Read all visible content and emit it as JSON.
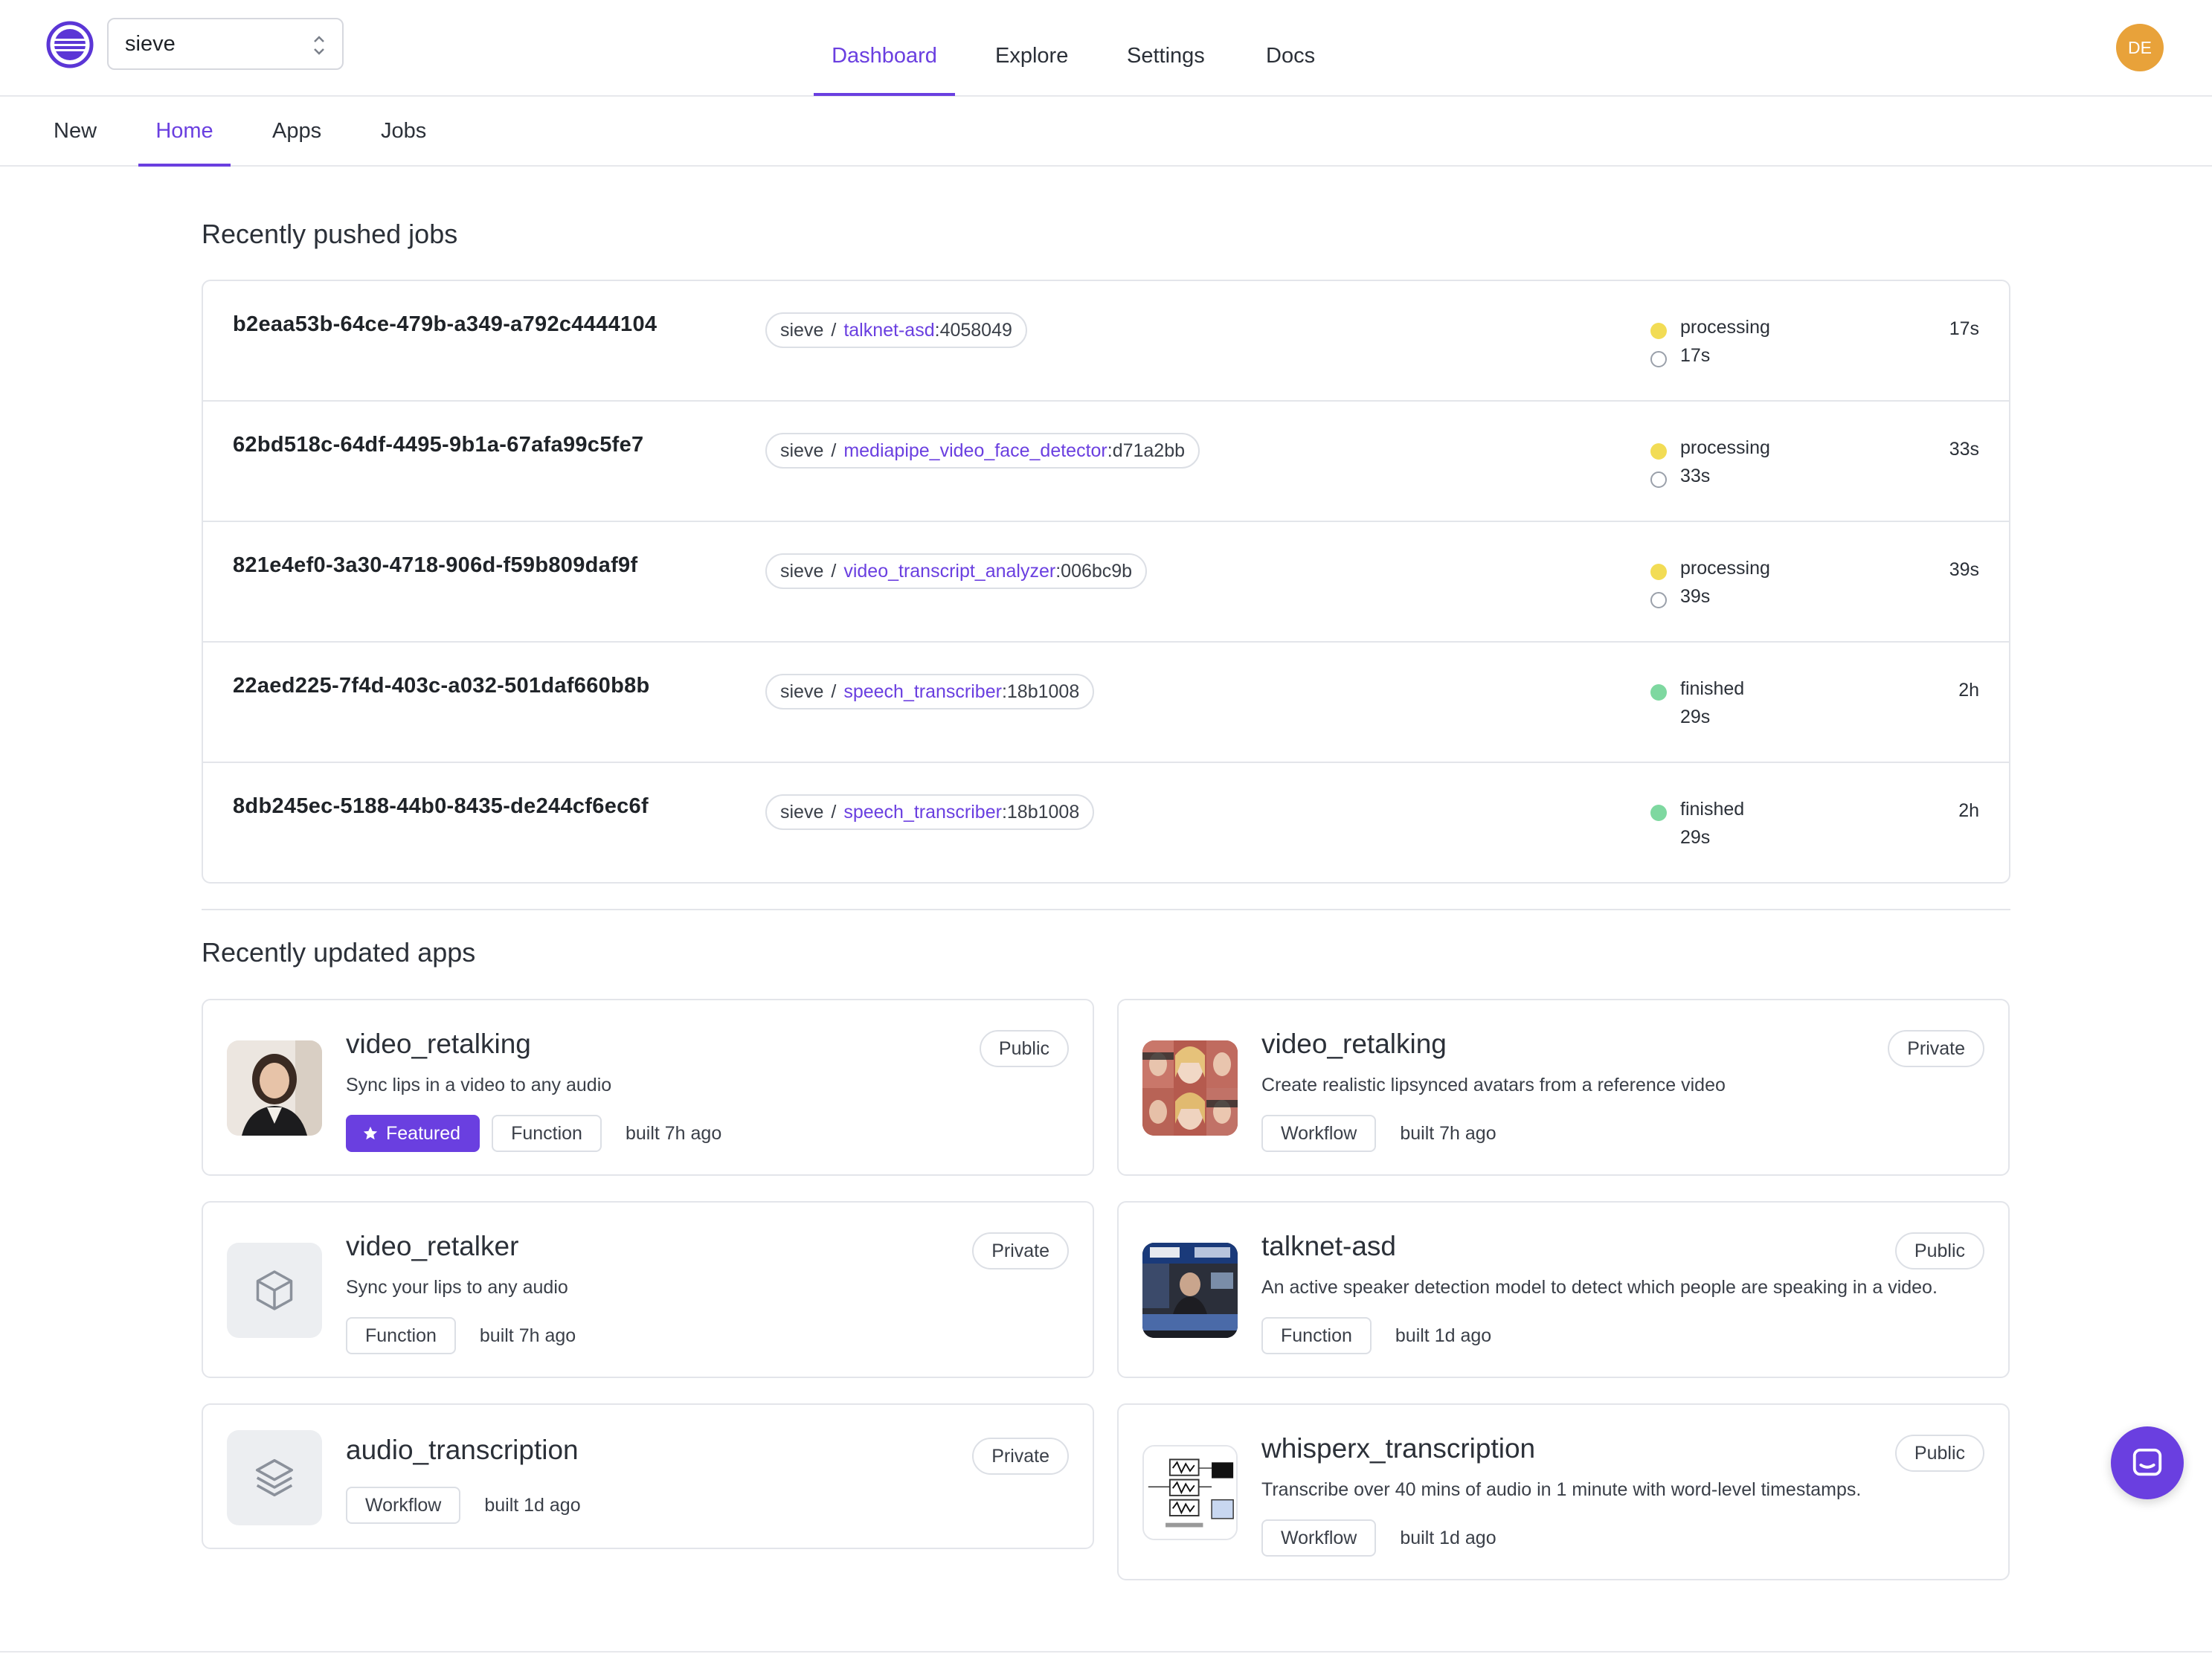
{
  "org_select": {
    "value": "sieve"
  },
  "nav": {
    "dashboard": "Dashboard",
    "explore": "Explore",
    "settings": "Settings",
    "docs": "Docs"
  },
  "user": {
    "initials": "DE"
  },
  "subnav": {
    "new": "New",
    "home": "Home",
    "apps": "Apps",
    "jobs": "Jobs"
  },
  "sections": {
    "jobs_title": "Recently pushed jobs",
    "apps_title": "Recently updated apps"
  },
  "jobs": [
    {
      "id": "b2eaa53b-64ce-479b-a349-a792c4444104",
      "owner": "sieve",
      "sep": "/",
      "app": "talknet-asd",
      "version": ":4058049",
      "status": "processing",
      "status_sub": "17s",
      "duration": "17s"
    },
    {
      "id": "62bd518c-64df-4495-9b1a-67afa99c5fe7",
      "owner": "sieve",
      "sep": "/",
      "app": "mediapipe_video_face_detector",
      "version": ":d71a2bb",
      "status": "processing",
      "status_sub": "33s",
      "duration": "33s"
    },
    {
      "id": "821e4ef0-3a30-4718-906d-f59b809daf9f",
      "owner": "sieve",
      "sep": "/",
      "app": "video_transcript_analyzer",
      "version": ":006bc9b",
      "status": "processing",
      "status_sub": "39s",
      "duration": "39s"
    },
    {
      "id": "22aed225-7f4d-403c-a032-501daf660b8b",
      "owner": "sieve",
      "sep": "/",
      "app": "speech_transcriber",
      "version": ":18b1008",
      "status": "finished",
      "status_sub": "29s",
      "duration": "2h"
    },
    {
      "id": "8db245ec-5188-44b0-8435-de244cf6ec6f",
      "owner": "sieve",
      "sep": "/",
      "app": "speech_transcriber",
      "version": ":18b1008",
      "status": "finished",
      "status_sub": "29s",
      "duration": "2h"
    }
  ],
  "status_colors": {
    "processing": "#f2dc55",
    "finished": "#7ed8a0"
  },
  "apps": [
    {
      "name": "video_retalking",
      "description": "Sync lips in a video to any audio",
      "visibility": "Public",
      "featured_label": "Featured",
      "type": "Function",
      "built": "built 7h ago",
      "thumb": "woman-photo"
    },
    {
      "name": "video_retalking",
      "description": "Create realistic lipsynced avatars from a reference video",
      "visibility": "Private",
      "type": "Workflow",
      "built": "built 7h ago",
      "thumb": "face-grid-photo"
    },
    {
      "name": "video_retalker",
      "description": "Sync your lips to any audio",
      "visibility": "Private",
      "type": "Function",
      "built": "built 7h ago",
      "thumb": "cube-icon"
    },
    {
      "name": "talknet-asd",
      "description": "An active speaker detection model to detect which people are speaking in a video.",
      "visibility": "Public",
      "type": "Function",
      "built": "built 1d ago",
      "thumb": "tv-studio-photo"
    },
    {
      "name": "audio_transcription",
      "description": "",
      "visibility": "Private",
      "type": "Workflow",
      "built": "built 1d ago",
      "thumb": "layers-icon"
    },
    {
      "name": "whisperx_transcription",
      "description": "Transcribe over 40 mins of audio in 1 minute with word-level timestamps.",
      "visibility": "Public",
      "type": "Workflow",
      "built": "built 1d ago",
      "thumb": "diagram-photo"
    }
  ],
  "brand_color": "#6a3fe0",
  "icons": {
    "logo": "sieve-logo",
    "select": "chevron-updown-icon",
    "featured": "star-icon",
    "chat": "chat-bubble-icon"
  }
}
